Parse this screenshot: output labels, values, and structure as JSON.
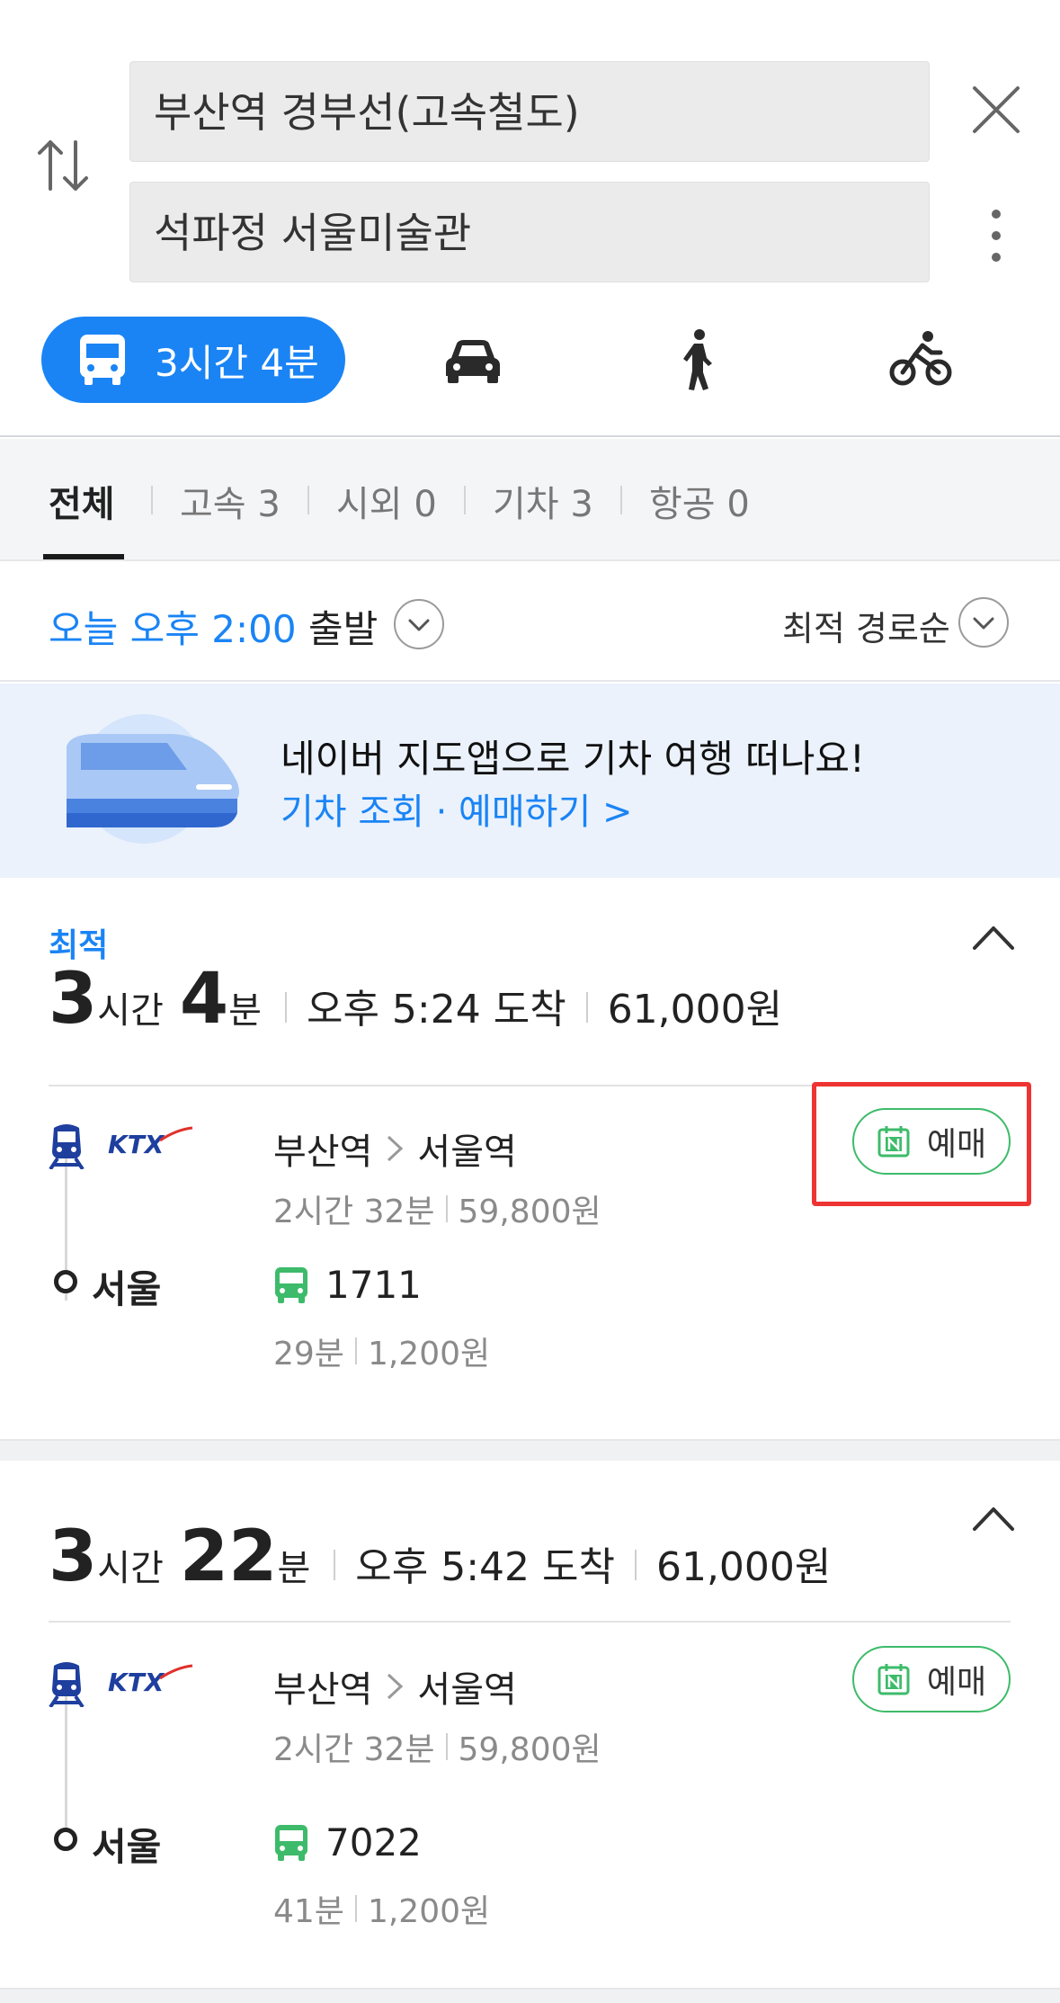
{
  "search": {
    "origin": "부산역 경부선(고속철도)",
    "destination": "석파정 서울미술관"
  },
  "modes": {
    "active_label": "3시간 4분",
    "items": [
      "bus-icon",
      "car-icon",
      "walk-icon",
      "bike-icon"
    ]
  },
  "categories": [
    {
      "label": "전체",
      "active": true
    },
    {
      "label": "고속 3"
    },
    {
      "label": "시외 0"
    },
    {
      "label": "기차 3"
    },
    {
      "label": "항공 0"
    }
  ],
  "departure": {
    "time": "오늘 오후 2:00",
    "word": "출발",
    "sort": "최적 경로순"
  },
  "promo": {
    "title": "네이버 지도앱으로 기차 여행 떠나요!",
    "link": "기차 조회 · 예매하기 >"
  },
  "routes": [
    {
      "tag": "최적",
      "hours": "3",
      "hours_unit": "시간",
      "minutes": "4",
      "minutes_unit": "분",
      "arrival": "오후 5:24 도착",
      "price": "61,000원",
      "train": {
        "from": "부산역",
        "to": "서울역",
        "duration": "2시간 32분",
        "fare": "59,800원",
        "book_label": "예매"
      },
      "transfer_stop": "서울",
      "bus": {
        "number": "1711",
        "duration": "29분",
        "fare": "1,200원"
      }
    },
    {
      "hours": "3",
      "hours_unit": "시간",
      "minutes": "22",
      "minutes_unit": "분",
      "arrival": "오후 5:42 도착",
      "price": "61,000원",
      "train": {
        "from": "부산역",
        "to": "서울역",
        "duration": "2시간 32분",
        "fare": "59,800원",
        "book_label": "예매"
      },
      "transfer_stop": "서울",
      "bus": {
        "number": "7022",
        "duration": "41분",
        "fare": "1,200원"
      }
    }
  ],
  "colors": {
    "accent": "#1a84f5",
    "bus_green": "#3dbb6a",
    "ktx_blue": "#1e3f9e",
    "highlight_red": "#ee3333"
  }
}
